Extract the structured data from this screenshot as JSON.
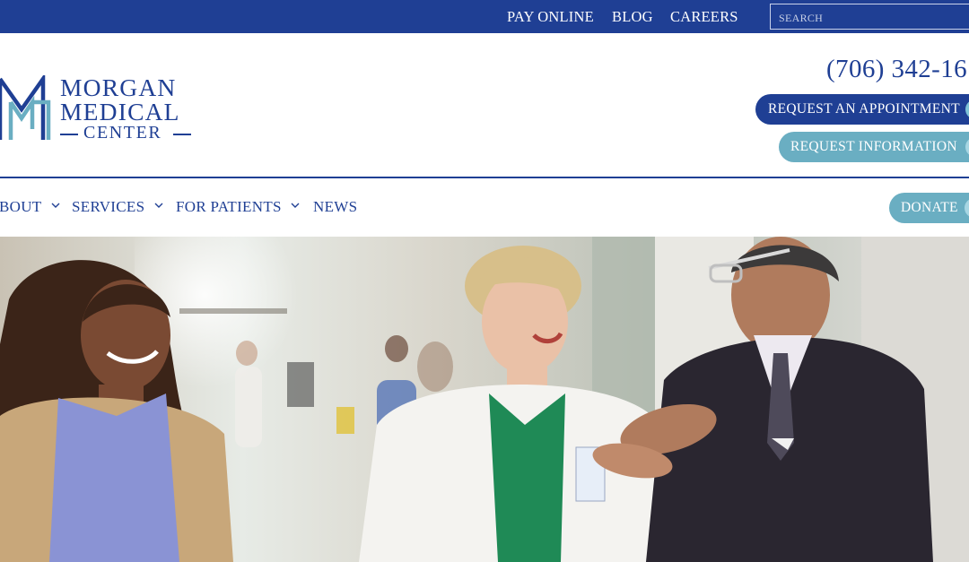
{
  "topbar": {
    "links": [
      "PAY ONLINE",
      "BLOG",
      "CAREERS"
    ],
    "search": {
      "placeholder": "SEARCH",
      "value": ""
    }
  },
  "logo": {
    "line1": "MORGAN",
    "line2": "MEDICAL",
    "line3": "CENTER"
  },
  "header": {
    "phone": "(706) 342-16",
    "request_appointment": "REQUEST AN APPOINTMENT",
    "request_information": "REQUEST INFORMATION"
  },
  "nav": {
    "items": [
      {
        "label": "BOUT",
        "has_dropdown": true
      },
      {
        "label": "SERVICES",
        "has_dropdown": true
      },
      {
        "label": "FOR PATIENTS",
        "has_dropdown": true
      },
      {
        "label": "NEWS",
        "has_dropdown": false
      }
    ],
    "donate": "DONATE"
  },
  "colors": {
    "brand_navy": "#1f3f94",
    "accent_teal": "#6aaec2",
    "accent_light": "#7fc3d6"
  },
  "icons": {
    "logo": "morgan-medical-m-logo-icon",
    "dropdown": "chevron-down-icon",
    "pill_end": "circle-icon"
  }
}
